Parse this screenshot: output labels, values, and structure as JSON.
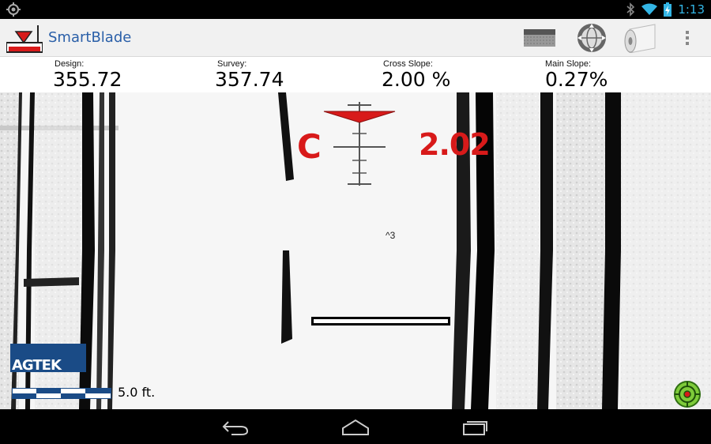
{
  "status_bar": {
    "time": "1:13",
    "icons": [
      "notification-icon",
      "bluetooth-icon",
      "wifi-icon",
      "battery-icon"
    ]
  },
  "action_bar": {
    "title": "SmartBlade",
    "icons": [
      "surface-icon",
      "globe-icon",
      "paper-roll-icon",
      "overflow-menu-icon"
    ]
  },
  "readings": {
    "design": {
      "label": "Design:",
      "value": "355.72"
    },
    "survey": {
      "label": "Survey:",
      "value": "357.74"
    },
    "cross_slope": {
      "label": "Cross Slope:",
      "value": "2.00 %"
    },
    "main_slope": {
      "label": "Main Slope:",
      "value": "0.27%"
    }
  },
  "map": {
    "grade_letter": "C",
    "grade_value": "2.02",
    "cursor_mark": "^3",
    "logo": "AGTEK",
    "scale_label": "5.0 ft."
  },
  "colors": {
    "accent_red": "#d81a1a",
    "brand_blue": "#1a4b86",
    "title_blue": "#2a5fa8",
    "clock_blue": "#33b5e5"
  },
  "nav_bar": {
    "icons": [
      "back-icon",
      "home-icon",
      "recent-apps-icon"
    ]
  }
}
